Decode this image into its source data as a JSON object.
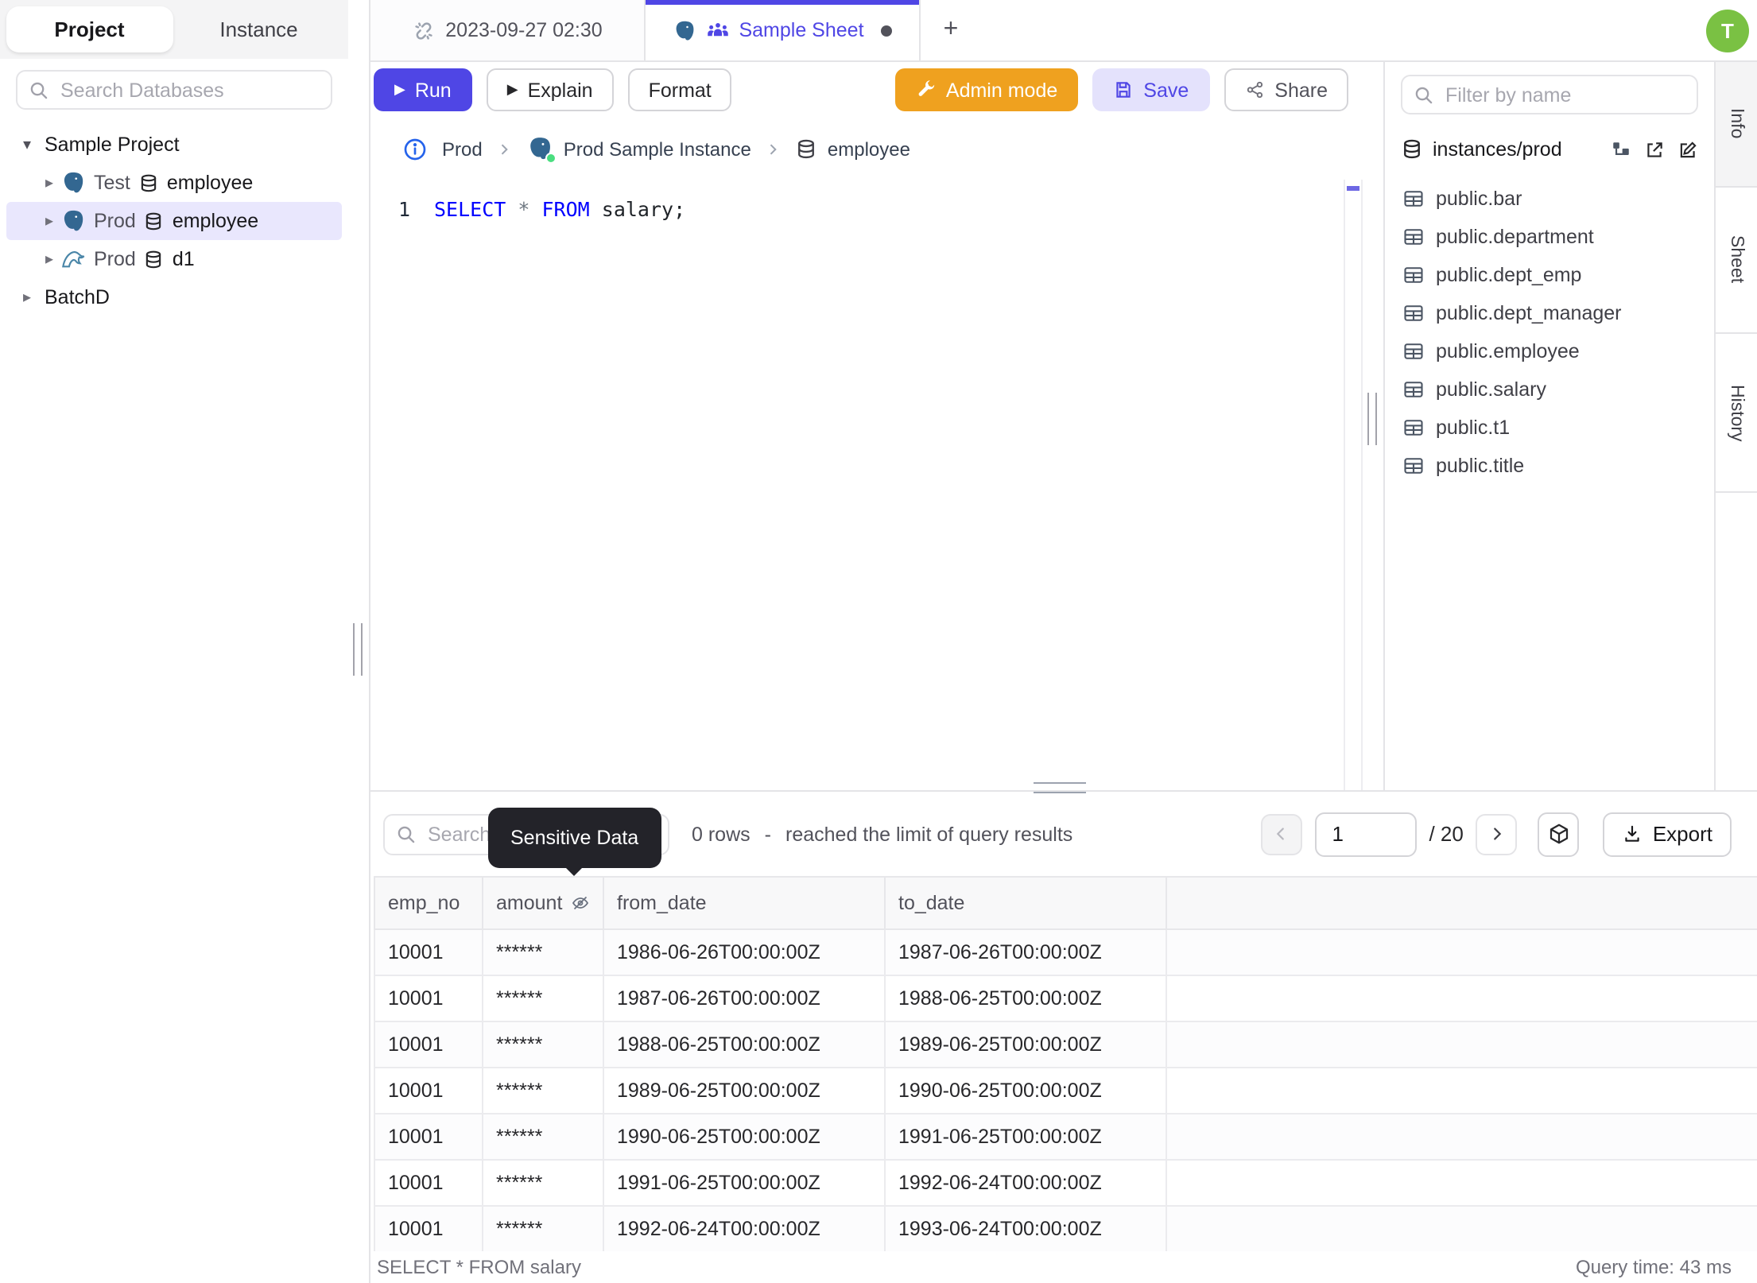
{
  "sidebar": {
    "tabs": {
      "project": "Project",
      "instance": "Instance"
    },
    "search_placeholder": "Search Databases",
    "tree": {
      "project1": "Sample Project",
      "items": [
        {
          "env": "Test",
          "db": "employee",
          "engine": "postgres"
        },
        {
          "env": "Prod",
          "db": "employee",
          "engine": "postgres",
          "selected": true
        },
        {
          "env": "Prod",
          "db": "d1",
          "engine": "mysql"
        }
      ],
      "project2": "BatchD"
    }
  },
  "tabbar": {
    "tab1": "2023-09-27 02:30",
    "tab2": "Sample Sheet",
    "new_tab": "+",
    "avatar_initial": "T"
  },
  "toolbar": {
    "run": "Run",
    "explain": "Explain",
    "format": "Format",
    "admin_mode": "Admin mode",
    "save": "Save",
    "share": "Share"
  },
  "breadcrumb": {
    "env": "Prod",
    "instance": "Prod Sample Instance",
    "database": "employee"
  },
  "editor": {
    "line_number": "1",
    "kw_select": "SELECT",
    "star": "*",
    "kw_from": "FROM",
    "rest": "salary;"
  },
  "schema_panel": {
    "filter_placeholder": "Filter by name",
    "database_path": "instances/prod",
    "tables": [
      "public.bar",
      "public.department",
      "public.dept_emp",
      "public.dept_manager",
      "public.employee",
      "public.salary",
      "public.t1",
      "public.title"
    ]
  },
  "side_tabs": {
    "info": "Info",
    "sheet": "Sheet",
    "history": "History"
  },
  "results": {
    "search_placeholder": "Search",
    "tooltip": "Sensitive Data",
    "rows_count": "0 rows",
    "separator": "-",
    "limit_text": "reached the limit of query results",
    "pagination": {
      "page": "1",
      "total": "/ 20",
      "export_label": "Export"
    },
    "table": {
      "columns": [
        "emp_no",
        "amount",
        "from_date",
        "to_date"
      ],
      "rows": [
        [
          "10001",
          "******",
          "1986-06-26T00:00:00Z",
          "1987-06-26T00:00:00Z"
        ],
        [
          "10001",
          "******",
          "1987-06-26T00:00:00Z",
          "1988-06-25T00:00:00Z"
        ],
        [
          "10001",
          "******",
          "1988-06-25T00:00:00Z",
          "1989-06-25T00:00:00Z"
        ],
        [
          "10001",
          "******",
          "1989-06-25T00:00:00Z",
          "1990-06-25T00:00:00Z"
        ],
        [
          "10001",
          "******",
          "1990-06-25T00:00:00Z",
          "1991-06-25T00:00:00Z"
        ],
        [
          "10001",
          "******",
          "1991-06-25T00:00:00Z",
          "1992-06-24T00:00:00Z"
        ],
        [
          "10001",
          "******",
          "1992-06-24T00:00:00Z",
          "1993-06-24T00:00:00Z"
        ]
      ]
    },
    "status_sql": "SELECT * FROM salary",
    "query_time": "Query time: 43 ms"
  },
  "colors": {
    "accent": "#4f46e5",
    "admin_orange": "#efa11f",
    "avatar_green": "#7ac143",
    "selected_row": "#e9e7fd",
    "keyword_blue": "#0000ff",
    "status_green": "#4ade80",
    "tooltip_bg": "#232329"
  }
}
